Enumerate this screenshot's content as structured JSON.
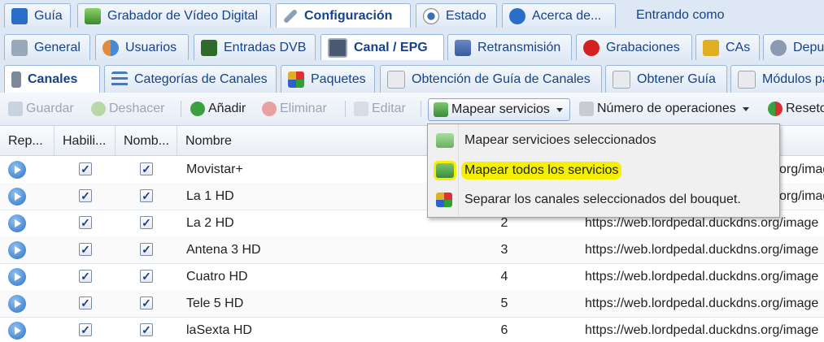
{
  "top_tabs": [
    {
      "icon": "epg-icon",
      "label": "Guía"
    },
    {
      "icon": "download-icon",
      "label": "Grabador de Vídeo Digital"
    },
    {
      "icon": "wrench-icon",
      "label": "Configuración",
      "active": true
    },
    {
      "icon": "eye-icon",
      "label": "Estado"
    },
    {
      "icon": "info-icon",
      "label": "Acerca de..."
    }
  ],
  "login_text": "Entrando como",
  "config_tabs": [
    {
      "icon": "wrench-icon",
      "label": "General"
    },
    {
      "icon": "users-icon",
      "label": "Usuarios"
    },
    {
      "icon": "dvb-icon",
      "label": "Entradas DVB"
    },
    {
      "icon": "tv-icon",
      "label": "Canal / EPG",
      "active": true
    },
    {
      "icon": "stream-icon",
      "label": "Retransmisión"
    },
    {
      "icon": "rec-icon",
      "label": "Grabaciones"
    },
    {
      "icon": "key-icon",
      "label": "CAs"
    },
    {
      "icon": "debug-icon",
      "label": "Depu"
    }
  ],
  "channel_tabs": [
    {
      "icon": "remote-icon",
      "label": "Canales",
      "active": true
    },
    {
      "icon": "tree-icon",
      "label": "Categorías de Canales"
    },
    {
      "icon": "grid-icon",
      "label": "Paquetes"
    },
    {
      "icon": "calendar-icon",
      "label": "Obtención de Guía de Canales"
    },
    {
      "icon": "calendar-icon",
      "label": "Obtener Guía"
    },
    {
      "icon": "calendar-icon",
      "label": "Módulos pa"
    }
  ],
  "toolbar": {
    "save": "Guardar",
    "undo": "Deshacer",
    "add": "Añadir",
    "delete": "Eliminar",
    "edit": "Editar",
    "map_services": "Mapear servicios",
    "operations": "Número de operaciones",
    "reset": "Reseto"
  },
  "columns": [
    "Rep...",
    "Habili...",
    "Nomb...",
    "Nombre"
  ],
  "rows": [
    {
      "name": "Movistar+",
      "number": "",
      "icon_url": "org/image"
    },
    {
      "name": "La 1 HD",
      "number": "",
      "icon_url": "org/image"
    },
    {
      "name": "La 2 HD",
      "number": "2",
      "icon_url": "https://web.lordpedal.duckdns.org/image"
    },
    {
      "name": "Antena 3 HD",
      "number": "3",
      "icon_url": "https://web.lordpedal.duckdns.org/image"
    },
    {
      "name": "Cuatro HD",
      "number": "4",
      "icon_url": "https://web.lordpedal.duckdns.org/image"
    },
    {
      "name": "Tele 5 HD",
      "number": "5",
      "icon_url": "https://web.lordpedal.duckdns.org/image"
    },
    {
      "name": "laSexta HD",
      "number": "6",
      "icon_url": "https://web.lordpedal.duckdns.org/image"
    }
  ],
  "dropdown_menu": [
    {
      "icon": "map-selected-icon",
      "label": "Mapear servicioes seleccionados"
    },
    {
      "icon": "map-all-icon",
      "label": "Mapear todos los servicios",
      "highlighted": true
    },
    {
      "icon": "split-icon",
      "label": "Separar los canales seleccionados del bouquet."
    }
  ],
  "colors": {
    "highlight": "#f4f000",
    "tab_bg": "#dde8f4",
    "link_text": "#15428b"
  }
}
